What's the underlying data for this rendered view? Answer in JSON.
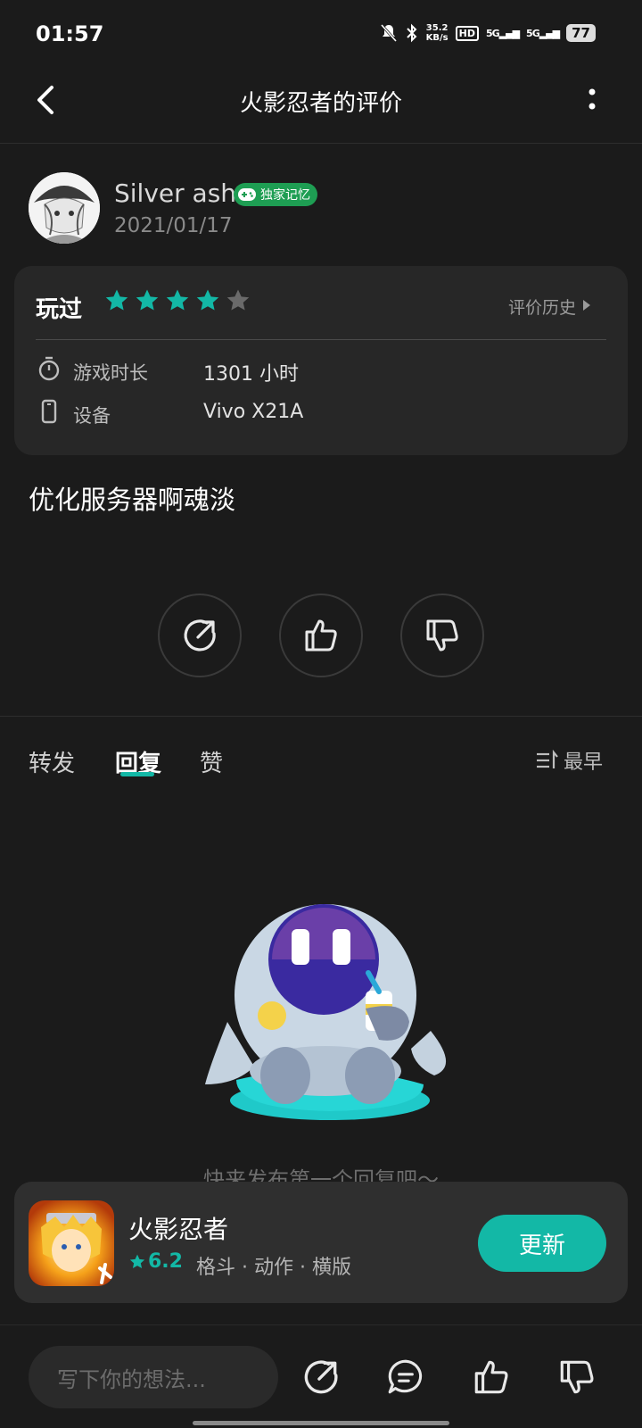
{
  "status_bar": {
    "time": "01:57",
    "net_speed_value": "35.2",
    "net_speed_unit": "KB/s",
    "hd_label": "HD",
    "signal_1": "5G",
    "signal_2": "5G",
    "battery": "77"
  },
  "header": {
    "title": "火影忍者的评价"
  },
  "user": {
    "name": "Silver ash",
    "badge": "独家记忆",
    "date": "2021/01/17"
  },
  "review_card": {
    "played_label": "玩过",
    "rating_stars": 4,
    "rating_max": 5,
    "history_label": "评价历史",
    "play_time_label": "游戏时长",
    "play_time_value": "1301 小时",
    "device_label": "设备",
    "device_value": "Vivo X21A"
  },
  "review": {
    "text": "优化服务器啊魂淡"
  },
  "tabs": {
    "items": [
      {
        "label": "转发"
      },
      {
        "label": "回复"
      },
      {
        "label": "赞"
      }
    ],
    "active": "回复",
    "sort_label": "最早"
  },
  "empty_state": {
    "hint": "快来发布第一个回复吧～"
  },
  "game": {
    "name": "火影忍者",
    "rating": "6.2",
    "tags": "格斗 · 动作 · 横版",
    "action_label": "更新"
  },
  "bottom_bar": {
    "input_placeholder": "写下你的想法..."
  },
  "colors": {
    "accent": "#13b8a6",
    "badge": "#1e9e53",
    "background": "#1b1b1b",
    "card": "#272727"
  }
}
